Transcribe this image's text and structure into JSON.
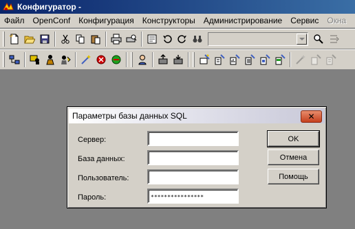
{
  "window": {
    "title": "Конфигуратор -"
  },
  "menu": [
    {
      "label": "Файл",
      "enabled": true
    },
    {
      "label": "OpenConf",
      "enabled": true
    },
    {
      "label": "Конфигурация",
      "enabled": true
    },
    {
      "label": "Конструкторы",
      "enabled": true
    },
    {
      "label": "Администрирование",
      "enabled": true
    },
    {
      "label": "Сервис",
      "enabled": true
    },
    {
      "label": "Окна",
      "enabled": false
    }
  ],
  "toolbar1": {
    "icons": [
      "new-file-icon",
      "open-folder-icon",
      "save-icon",
      "cut-icon",
      "copy-icon",
      "paste-icon",
      "print-icon",
      "print-preview-icon",
      "find-icon",
      "undo-icon",
      "redo-icon",
      "binoculars-icon",
      "search-combo",
      "find-in-files-icon",
      "replace-icon"
    ],
    "search_value": ""
  },
  "toolbar2": {
    "icons": [
      "db-structure-icon",
      "users-icon",
      "user-rights-icon",
      "user-edit-icon",
      "wand-icon",
      "debug-stop-icon",
      "debug-run-icon",
      "person-icon",
      "export-icon",
      "import-icon",
      "wizard-form-icon",
      "wizard-doc-icon",
      "wizard-report-icon",
      "wizard-ref-icon",
      "wizard-journal-icon",
      "wizard-processing-icon",
      "wizard-disabled-1-icon",
      "wizard-disabled-2-icon",
      "wizard-disabled-3-icon"
    ]
  },
  "colors": {
    "desktop": "#808080",
    "chrome": "#d4d0c8",
    "titlebar_start": "#0a246a",
    "close_button": "#c5401e"
  },
  "dialog": {
    "title": "Параметры базы данных SQL",
    "close_glyph": "✕",
    "fields": [
      {
        "label": "Сервер:",
        "value": ""
      },
      {
        "label": "База данных:",
        "value": ""
      },
      {
        "label": "Пользователь:",
        "value": ""
      },
      {
        "label": "Пароль:",
        "value": "****************"
      }
    ],
    "buttons": {
      "ok": "OK",
      "cancel": "Отмена",
      "help": "Помощь"
    }
  }
}
